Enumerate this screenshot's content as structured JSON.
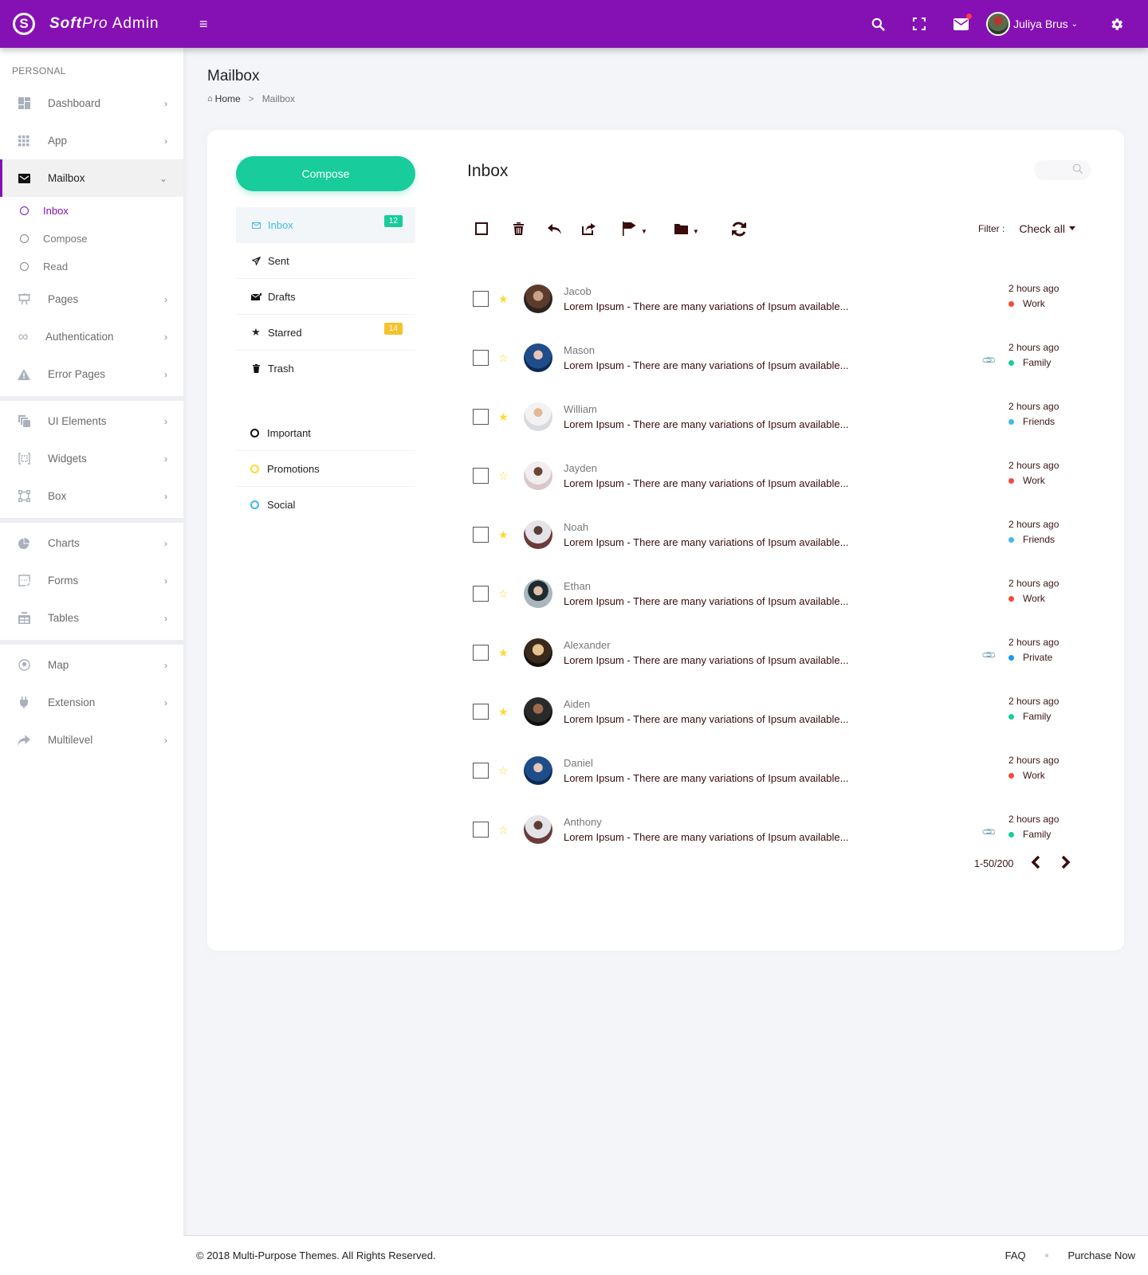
{
  "header": {
    "brand_bold": "Soft",
    "brand_italic": "Pro",
    "brand_rest": " Admin",
    "logo_letter": "S",
    "user_name": "Juliya Brus",
    "notification_dot_color": "#ff3d3d",
    "bar_color": "#8511b4"
  },
  "sidebar": {
    "section": "PERSONAL",
    "items": [
      {
        "label": "Dashboard",
        "icon": "dashboard-icon"
      },
      {
        "label": "App",
        "icon": "apps-grid-icon"
      },
      {
        "label": "Mailbox",
        "icon": "mail-icon",
        "active": true
      },
      {
        "label": "Pages",
        "icon": "presentation-icon"
      },
      {
        "label": "Authentication",
        "icon": "infinity-icon"
      },
      {
        "label": "Error Pages",
        "icon": "warning-icon"
      },
      {
        "label": "UI Elements",
        "icon": "layers-icon"
      },
      {
        "label": "Widgets",
        "icon": "widget-icon"
      },
      {
        "label": "Box",
        "icon": "box-icon"
      },
      {
        "label": "Charts",
        "icon": "pie-chart-icon"
      },
      {
        "label": "Forms",
        "icon": "form-icon"
      },
      {
        "label": "Tables",
        "icon": "table-icon"
      },
      {
        "label": "Map",
        "icon": "map-pin-icon"
      },
      {
        "label": "Extension",
        "icon": "plug-icon"
      },
      {
        "label": "Multilevel",
        "icon": "share-arrow-icon"
      }
    ],
    "mailbox_sub": [
      {
        "label": "Inbox",
        "active": true
      },
      {
        "label": "Compose"
      },
      {
        "label": "Read"
      }
    ]
  },
  "page": {
    "title": "Mailbox",
    "breadcrumb_home": "Home",
    "breadcrumb_sep": ">",
    "breadcrumb_current": "Mailbox"
  },
  "mail": {
    "compose_label": "Compose",
    "folders": [
      {
        "label": "Inbox",
        "icon": "envelope-icon",
        "badge": "12",
        "badge_color": "#19cc9c",
        "active": true
      },
      {
        "label": "Sent",
        "icon": "paper-plane-icon"
      },
      {
        "label": "Drafts",
        "icon": "draft-envelope-icon"
      },
      {
        "label": "Starred",
        "icon": "star-icon",
        "badge": "14",
        "badge_color": "#f4c22b"
      },
      {
        "label": "Trash",
        "icon": "trash-icon"
      }
    ],
    "labels": [
      {
        "label": "Important",
        "color": "#111111"
      },
      {
        "label": "Promotions",
        "color": "#ffd92e"
      },
      {
        "label": "Social",
        "color": "#42b9e8"
      }
    ],
    "inbox_title": "Inbox",
    "filter_label": "Filter :",
    "filter_value": "Check all",
    "pagination_text": "1-50/200",
    "messages": [
      {
        "from": "Jacob",
        "subject": "Lorem Ipsum - There are many variations of Ipsum available...",
        "time": "2 hours ago",
        "tag": "Work",
        "tag_color": "#f44b3b",
        "starred": true,
        "attachment": false
      },
      {
        "from": "Mason",
        "subject": "Lorem Ipsum - There are many variations of Ipsum available...",
        "time": "2 hours ago",
        "tag": "Family",
        "tag_color": "#19cc9c",
        "starred": false,
        "attachment": true
      },
      {
        "from": "William",
        "subject": "Lorem Ipsum - There are many variations of Ipsum available...",
        "time": "2 hours ago",
        "tag": "Friends",
        "tag_color": "#42b9e8",
        "starred": true,
        "attachment": false
      },
      {
        "from": "Jayden",
        "subject": "Lorem Ipsum - There are many variations of Ipsum available...",
        "time": "2 hours ago",
        "tag": "Work",
        "tag_color": "#f44b3b",
        "starred": false,
        "attachment": false
      },
      {
        "from": "Noah",
        "subject": "Lorem Ipsum - There are many variations of Ipsum available...",
        "time": "2 hours ago",
        "tag": "Friends",
        "tag_color": "#42b9e8",
        "starred": true,
        "attachment": false
      },
      {
        "from": "Ethan",
        "subject": "Lorem Ipsum - There are many variations of Ipsum available...",
        "time": "2 hours ago",
        "tag": "Work",
        "tag_color": "#f44b3b",
        "starred": false,
        "attachment": false
      },
      {
        "from": "Alexander",
        "subject": "Lorem Ipsum - There are many variations of Ipsum available...",
        "time": "2 hours ago",
        "tag": "Private",
        "tag_color": "#159bf4",
        "starred": true,
        "attachment": true
      },
      {
        "from": "Aiden",
        "subject": "Lorem Ipsum - There are many variations of Ipsum available...",
        "time": "2 hours ago",
        "tag": "Family",
        "tag_color": "#19cc9c",
        "starred": true,
        "attachment": false
      },
      {
        "from": "Daniel",
        "subject": "Lorem Ipsum - There are many variations of Ipsum available...",
        "time": "2 hours ago",
        "tag": "Work",
        "tag_color": "#f44b3b",
        "starred": false,
        "attachment": false
      },
      {
        "from": "Anthony",
        "subject": "Lorem Ipsum - There are many variations of Ipsum available...",
        "time": "2 hours ago",
        "tag": "Family",
        "tag_color": "#19cc9c",
        "starred": false,
        "attachment": true
      }
    ]
  },
  "footer": {
    "copyright": "© 2018 Multi-Purpose Themes. All Rights Reserved.",
    "faq": "FAQ",
    "purchase": "Purchase Now"
  }
}
